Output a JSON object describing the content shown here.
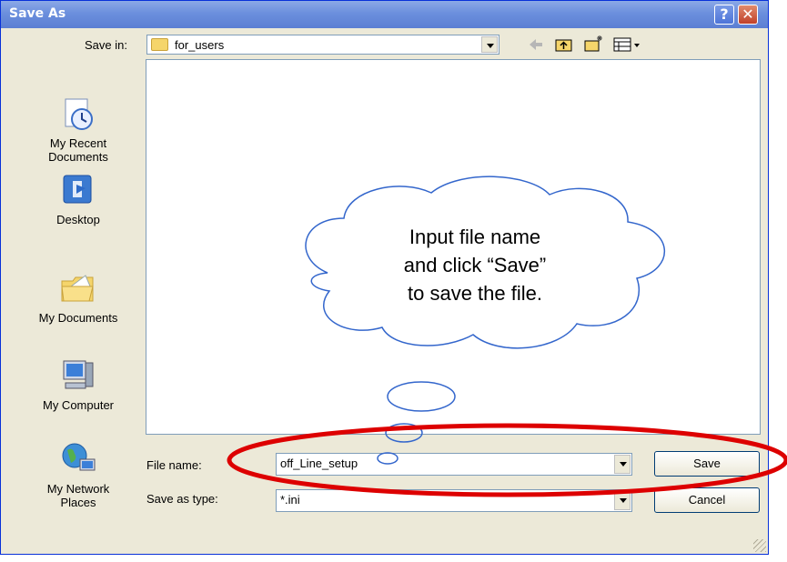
{
  "window": {
    "title": "Save As"
  },
  "titlebar": {
    "help_label": "?",
    "close_label": "✕"
  },
  "toolbar": {
    "save_in_label": "Save in:",
    "save_in_value": "for_users",
    "icons": [
      "back-arrow-icon",
      "up-folder-icon",
      "new-folder-icon",
      "views-menu-icon"
    ]
  },
  "places": [
    {
      "label": "My Recent\nDocuments",
      "icon": "recent-documents-icon"
    },
    {
      "label": "Desktop",
      "icon": "desktop-icon"
    },
    {
      "label": "My Documents",
      "icon": "my-documents-icon"
    },
    {
      "label": "My Computer",
      "icon": "my-computer-icon"
    },
    {
      "label": "My Network\nPlaces",
      "icon": "network-places-icon"
    }
  ],
  "form": {
    "file_name_label": "File name:",
    "file_name_value": "off_Line_setup",
    "save_type_label": "Save as type:",
    "save_type_value": "*.ini"
  },
  "buttons": {
    "save_label": "Save",
    "cancel_label": "Cancel"
  },
  "annotation": {
    "text": "Input file name\nand click “Save”\nto save the file.",
    "cloud_color": "#3366cc",
    "highlight_color": "#dd0000"
  },
  "colors": {
    "title_bar": "#6b8fdd",
    "dialog_bg": "#ece9d8",
    "input_border": "#7f9db9"
  }
}
